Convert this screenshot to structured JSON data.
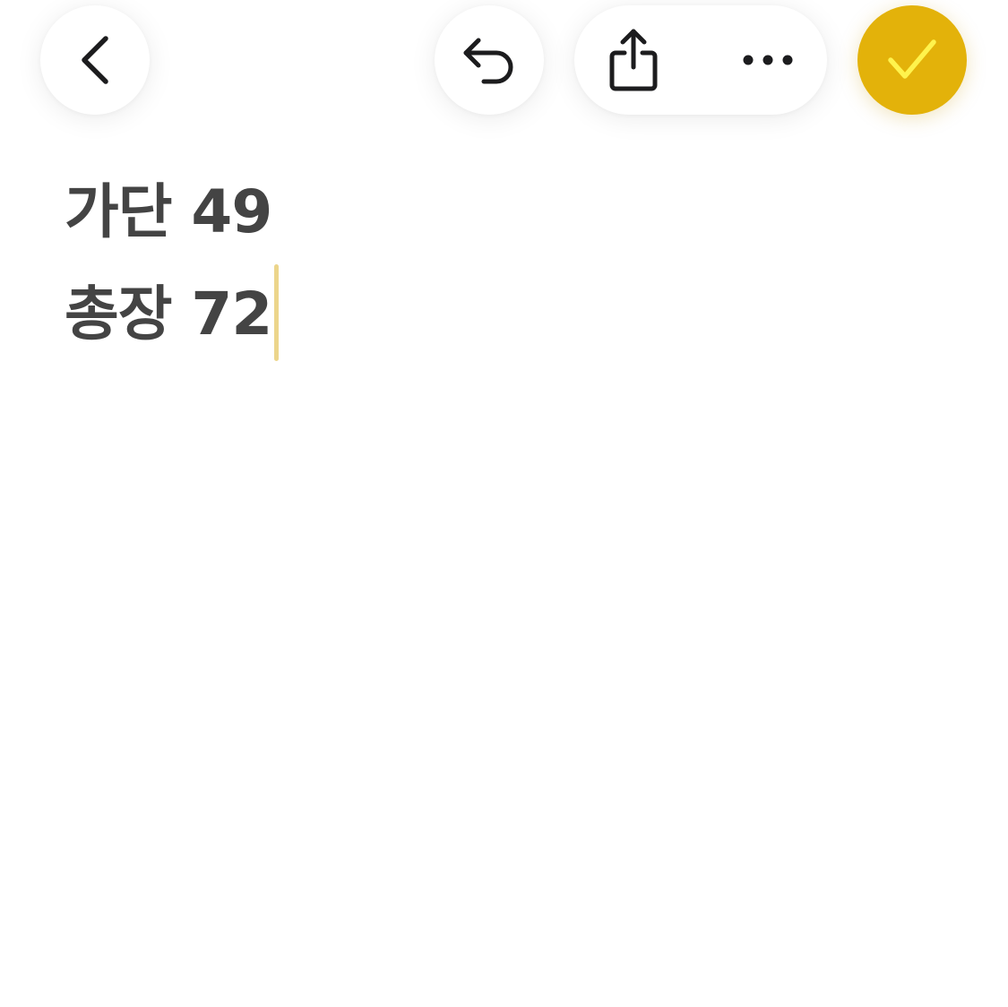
{
  "toolbar": {
    "back_icon": "chevron-left-icon",
    "undo_icon": "undo-icon",
    "share_icon": "share-icon",
    "more_icon": "ellipsis-icon",
    "done_icon": "checkmark-icon",
    "accent_color": "#e3b20a",
    "check_color": "#fff34d"
  },
  "note": {
    "lines": [
      "가단 49",
      "총장 72"
    ],
    "text_color": "#444444",
    "cursor_color": "#ecd58b"
  }
}
